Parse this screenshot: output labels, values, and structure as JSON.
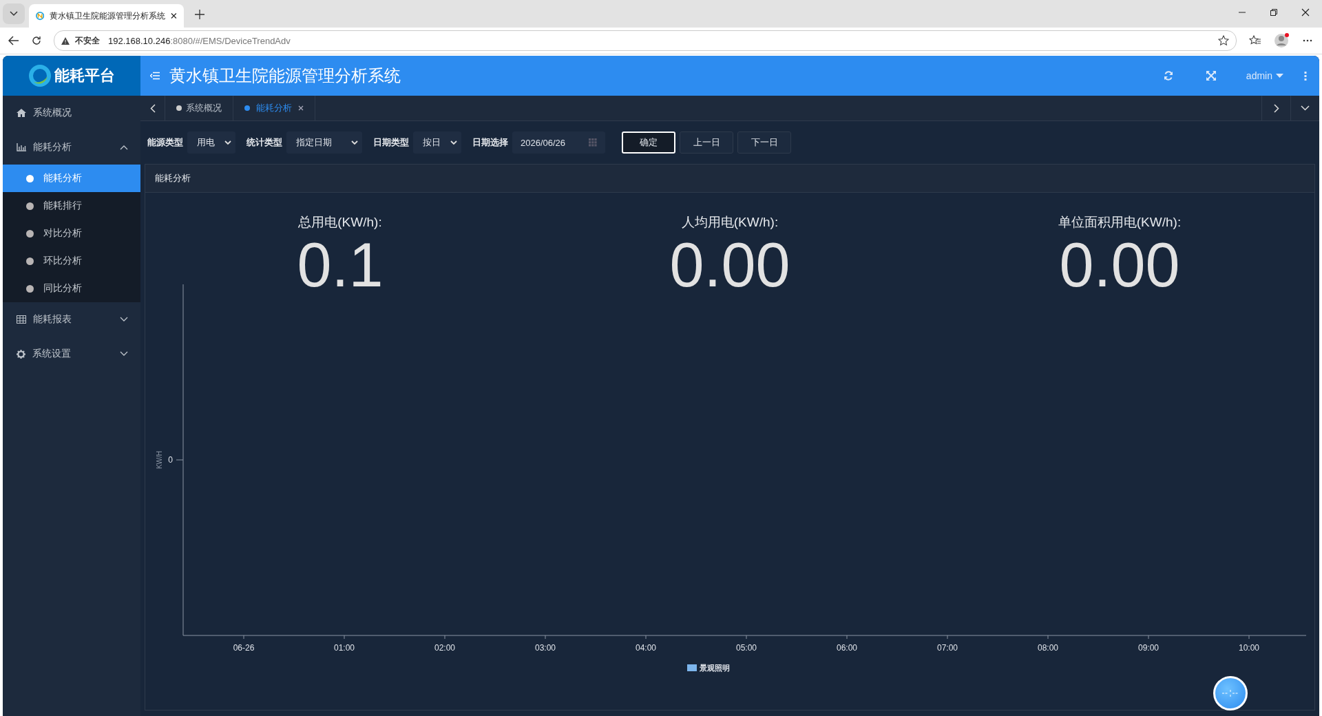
{
  "browser": {
    "tab_title": "黄水镇卫生院能源管理分析系统",
    "security": "不安全",
    "url_host": "192.168.10.246",
    "url_path": ":8080/#/EMS/DeviceTrendAdv"
  },
  "app": {
    "logo": "能耗平台",
    "title": "黄水镇卫生院能源管理分析系统",
    "user": "admin"
  },
  "sidebar": [
    {
      "label": "系统概况",
      "selected": false
    },
    {
      "label": "能耗分析",
      "expanded": true,
      "children": [
        {
          "label": "能耗分析",
          "selected": true
        },
        {
          "label": "能耗排行",
          "selected": false
        },
        {
          "label": "对比分析",
          "selected": false
        },
        {
          "label": "环比分析",
          "selected": false
        },
        {
          "label": "同比分析",
          "selected": false
        }
      ]
    },
    {
      "label": "能耗报表",
      "expanded": false
    },
    {
      "label": "系统设置",
      "expanded": false
    }
  ],
  "tabs": [
    {
      "label": "系统概况",
      "selected": false,
      "closable": false
    },
    {
      "label": "能耗分析",
      "selected": true,
      "closable": true
    }
  ],
  "filters": [
    {
      "label": "能源类型",
      "kind": "select",
      "value": "用电"
    },
    {
      "label": "统计类型",
      "kind": "select",
      "value": "指定日期"
    },
    {
      "label": "日期类型",
      "kind": "select",
      "value": "按日"
    },
    {
      "label": "日期选择",
      "kind": "date",
      "value": "2026/06/26"
    }
  ],
  "buttons": [
    {
      "label": "确定",
      "kind": "primary"
    },
    {
      "label": "上一日",
      "kind": "plain"
    },
    {
      "label": "下一日",
      "kind": "plain"
    }
  ],
  "panel": {
    "title": "能耗分析",
    "stats": [
      {
        "label": "总用电(KW/h):",
        "value": "0.1"
      },
      {
        "label": "人均用电(KW/h):",
        "value": "0.00"
      },
      {
        "label": "单位面积用电(KW/h):",
        "value": "0.00"
      }
    ],
    "chart": {
      "y_title": "KW/H",
      "y_tick": "0",
      "x_labels": [
        "06-26",
        "01:00",
        "02:00",
        "03:00",
        "04:00",
        "05:00",
        "06:00",
        "07:00",
        "08:00",
        "09:00",
        "10:00"
      ],
      "legend": [
        {
          "name": "景观照明",
          "color": "#7cb5ec"
        }
      ]
    }
  }
}
